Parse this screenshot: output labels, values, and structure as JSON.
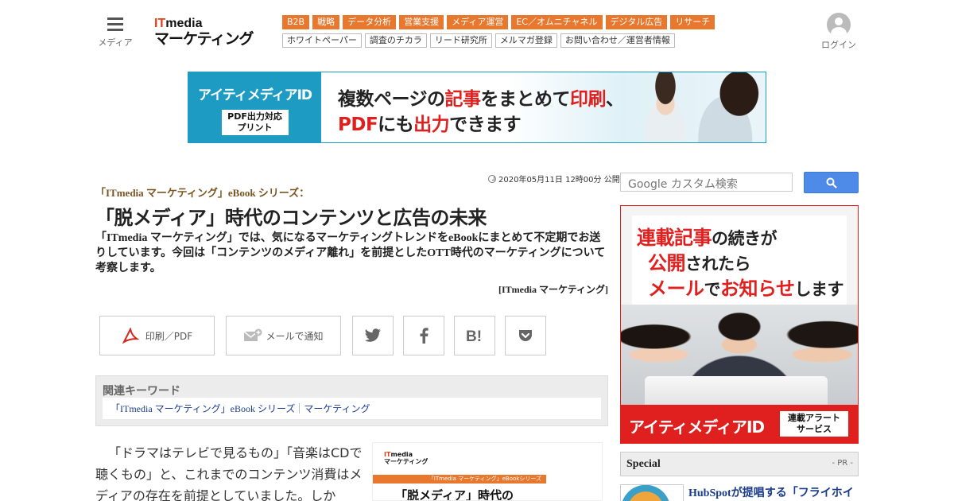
{
  "header": {
    "menu_label": "メディア",
    "logo_top_it": "IT",
    "logo_top_rest": "media",
    "logo_bottom": "マーケティング",
    "nav_primary": [
      "B2B",
      "戦略",
      "データ分析",
      "営業支援",
      "メディア運営",
      "EC／オムニチャネル",
      "デジタル広告",
      "リサーチ"
    ],
    "nav_secondary": [
      "ホワイトペーパー",
      "調査のチカラ",
      "リード研究所",
      "メルマガ登録",
      "お問い合わせ／運営者情報"
    ],
    "login_label": "ログイン"
  },
  "banner": {
    "left_title": "アイティメディアID",
    "left_sub_1": "PDF出力対応",
    "left_sub_2": "プリント",
    "msg1_a": "複数ページの",
    "msg1_b": "記事",
    "msg1_c": "をまとめて",
    "msg1_d": "印刷",
    "msg1_e": "、",
    "msg2_a": "PDF",
    "msg2_b": "にも",
    "msg2_c": "出力",
    "msg2_d": "できます"
  },
  "article": {
    "date": "2020年05月11日 12時00分 公開",
    "series": "「ITmedia マーケティング」eBook シリーズ：",
    "title": "「脱メディア」時代のコンテンツと広告の未来",
    "lead": "「ITmedia マーケティング」では、気になるマーケティングトレンドをeBookにまとめて不定期でお送りしています。今回は「コンテンツのメディア離れ」を前提としたOTT時代のマーケティングについて考察します。",
    "byline": "[ITmedia マーケティング]",
    "share": {
      "print_label": "印刷／PDF",
      "mail_label": "メールで通知"
    },
    "keywords_heading": "関連キーワード",
    "keywords": [
      "「ITmedia マーケティング」eBook シリーズ",
      "マーケティング"
    ],
    "body_text": "「ドラマはテレビで見るもの」「音楽はCDで聴くもの」と、これまでのコンテンツ消費はメディアの存在を前提としていました。しか",
    "thumb": {
      "logo_it": "IT",
      "logo_rest": "media",
      "logo_bottom": "マーケティング",
      "bar": "「ITmedia マーケティング」eBookシリーズ",
      "title": "「脱メディア」時代の"
    }
  },
  "sidebar": {
    "search_placeholder": "Google カスタム検索",
    "ad": {
      "l1_a": "連載記事",
      "l1_b": "の続きが",
      "l2_a": "公開",
      "l2_b": "されたら",
      "l3_a": "メール",
      "l3_b": "で",
      "l3_c": "お知らせ",
      "l3_d": "します",
      "foot_title": "アイティメディアID",
      "foot_sub_1": "連載アラート",
      "foot_sub_2": "サービス"
    },
    "special_heading": "Special",
    "special_pr": "- PR -",
    "promo_text": "HubSpotが提唱する「フライホイ"
  },
  "colors": {
    "nav_orange": "#e8782e",
    "accent_red": "#e0201f",
    "banner_blue": "#1d9bc2",
    "link_blue": "#1a3c8a",
    "search_button": "#4e8be9"
  }
}
